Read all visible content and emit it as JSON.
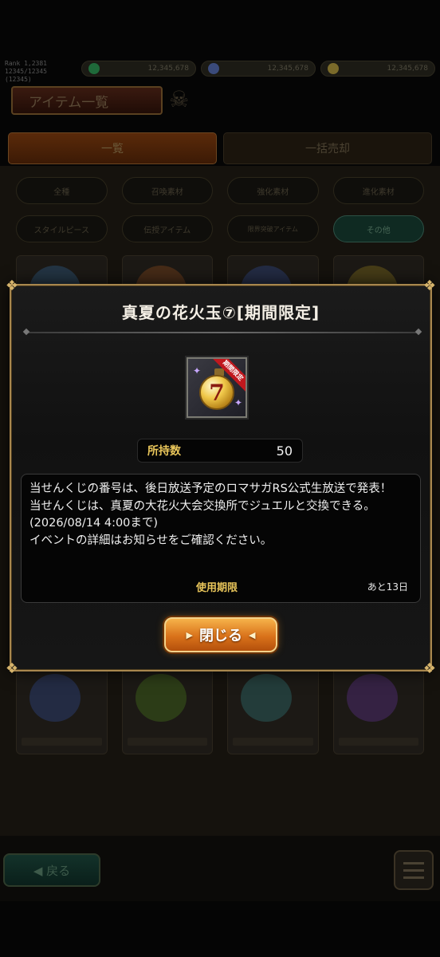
{
  "background": {
    "user_info": [
      "Rank  1,2381",
      "12345/12345 (12345)"
    ],
    "currencies": [
      {
        "name": "jewel",
        "amount": "12,345,678",
        "color": "#1f6a3a"
      },
      {
        "name": "crystal",
        "amount": "12,345,678",
        "color": "#3a4a7a"
      },
      {
        "name": "aurum",
        "amount": "12,345,678",
        "color": "#7a6a2a"
      }
    ],
    "screen_title": "アイテム一覧",
    "main_tabs": [
      {
        "label": "一覧",
        "active": true
      },
      {
        "label": "一括売却",
        "active": false
      }
    ],
    "filters": [
      {
        "label": "全種",
        "selected": false
      },
      {
        "label": "召喚素材",
        "selected": false
      },
      {
        "label": "強化素材",
        "selected": false
      },
      {
        "label": "進化素材",
        "selected": false
      },
      {
        "label": "スタイルピース",
        "selected": false
      },
      {
        "label": "伝授アイテム",
        "selected": false
      },
      {
        "label": "限界突破アイテム",
        "selected": false
      },
      {
        "label": "その他",
        "selected": true
      }
    ],
    "back_label": "◀ 戻る"
  },
  "dialog": {
    "title": "真夏の花火玉⑦[期間限定]",
    "item_badge": "期間限定",
    "item_number": "7",
    "owned_label": "所持数",
    "owned_value": "50",
    "description": "当せんくじの番号は、後日放送予定のロマサガRS公式生放送で発表！\n当せんくじは、真夏の大花火大会交換所でジュエルと交換できる。(2026/08/14 4:00まで)\nイベントの詳細はお知らせをご確認ください。",
    "expiry_label": "使用期限",
    "expiry_value": "あと13日",
    "close_label": "閉じる"
  }
}
